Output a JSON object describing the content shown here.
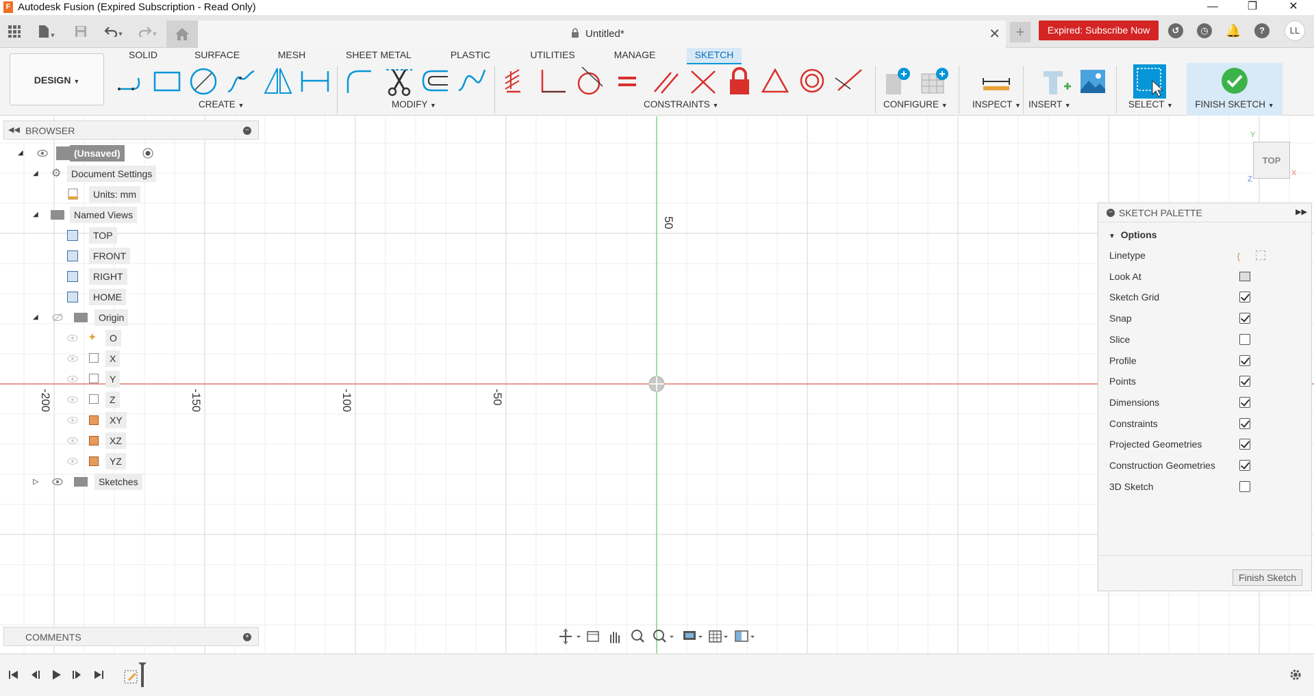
{
  "titlebar": {
    "app_icon_letter": "F",
    "title": "Autodesk Fusion (Expired Subscription - Read Only)",
    "minimize": "—",
    "restore": "❐",
    "close": "✕"
  },
  "tabbar": {
    "document_title": "Untitled*",
    "subscribe_label": "Expired: Subscribe Now",
    "avatar_initials": "LL",
    "help_label": "?"
  },
  "ribbon": {
    "workspace_label": "DESIGN",
    "tabs": [
      "SOLID",
      "SURFACE",
      "MESH",
      "SHEET METAL",
      "PLASTIC",
      "UTILITIES",
      "MANAGE",
      "SKETCH"
    ],
    "active_tab": "SKETCH",
    "groups": {
      "create": "CREATE",
      "modify": "MODIFY",
      "constraints": "CONSTRAINTS",
      "configure": "CONFIGURE",
      "inspect": "INSPECT",
      "insert": "INSERT",
      "select": "SELECT",
      "finish": "FINISH SKETCH"
    },
    "accent_color": "#0696d7",
    "constraint_color": "#d9302c"
  },
  "browser": {
    "title": "BROWSER",
    "root": "(Unsaved)",
    "document_settings": "Document Settings",
    "units": "Units: mm",
    "named_views": "Named Views",
    "views": [
      "TOP",
      "FRONT",
      "RIGHT",
      "HOME"
    ],
    "origin": "Origin",
    "origin_items": [
      "O",
      "X",
      "Y",
      "Z",
      "XY",
      "XZ",
      "YZ"
    ],
    "sketches": "Sketches"
  },
  "comments": {
    "title": "COMMENTS"
  },
  "canvas": {
    "axis_labels": [
      "-200",
      "-150",
      "-100",
      "-50",
      "50"
    ],
    "x_axis_color": "#e8776c",
    "y_axis_color": "#7ed47e"
  },
  "viewcube": {
    "face": "TOP",
    "axis_y": "Y",
    "axis_x": "X",
    "axis_z": "Z"
  },
  "palette": {
    "title": "SKETCH PALETTE",
    "options_header": "Options",
    "rows": [
      {
        "label": "Linetype",
        "kind": "icons"
      },
      {
        "label": "Look At",
        "kind": "icon"
      },
      {
        "label": "Sketch Grid",
        "checked": true
      },
      {
        "label": "Snap",
        "checked": true
      },
      {
        "label": "Slice",
        "checked": false
      },
      {
        "label": "Profile",
        "checked": true
      },
      {
        "label": "Points",
        "checked": true
      },
      {
        "label": "Dimensions",
        "checked": true
      },
      {
        "label": "Constraints",
        "checked": true
      },
      {
        "label": "Projected Geometries",
        "checked": true
      },
      {
        "label": "Construction Geometries",
        "checked": true
      },
      {
        "label": "3D Sketch",
        "checked": false
      }
    ],
    "finish_button": "Finish Sketch"
  }
}
